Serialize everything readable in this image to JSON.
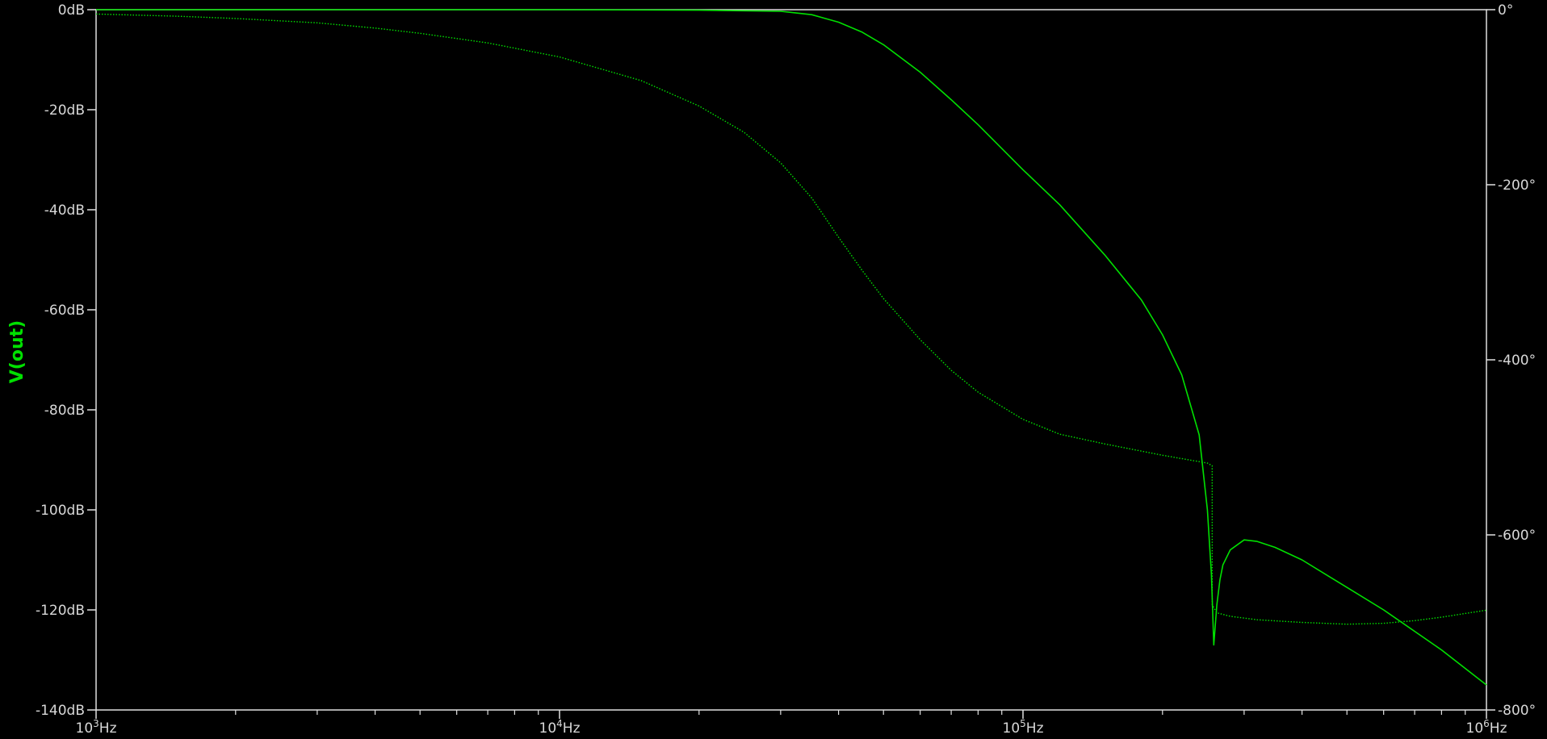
{
  "chart_data": {
    "type": "line",
    "ylabel": "V(out)",
    "x_scale": "log",
    "xlim": [
      1000,
      1000000
    ],
    "ylim_left": [
      -140,
      0
    ],
    "ylim_right": [
      -800,
      0
    ],
    "grid": false,
    "background_color": "#000000",
    "axis_color": "#e0e0e0",
    "trace_color": "#00e000",
    "x_ticks": [
      {
        "value": 1000,
        "base": "10",
        "exp": "3",
        "unit": "Hz"
      },
      {
        "value": 10000,
        "base": "10",
        "exp": "4",
        "unit": "Hz"
      },
      {
        "value": 100000,
        "base": "10",
        "exp": "5",
        "unit": "Hz"
      },
      {
        "value": 1000000,
        "base": "10",
        "exp": "6",
        "unit": "Hz"
      }
    ],
    "y_left_ticks": [
      {
        "value": 0,
        "label": "0dB"
      },
      {
        "value": -20,
        "label": "-20dB"
      },
      {
        "value": -40,
        "label": "-40dB"
      },
      {
        "value": -60,
        "label": "-60dB"
      },
      {
        "value": -80,
        "label": "-80dB"
      },
      {
        "value": -100,
        "label": "-100dB"
      },
      {
        "value": -120,
        "label": "-120dB"
      },
      {
        "value": -140,
        "label": "-140dB"
      }
    ],
    "y_right_ticks": [
      {
        "value": 0,
        "label": "0°"
      },
      {
        "value": -200,
        "label": "-200°"
      },
      {
        "value": -400,
        "label": "-400°"
      },
      {
        "value": -600,
        "label": "-600°"
      },
      {
        "value": -800,
        "label": "-800°"
      }
    ],
    "series": [
      {
        "axis": "left",
        "style": "solid",
        "x": [
          1000,
          5000,
          10000,
          20000,
          30000,
          35000,
          40000,
          45000,
          50000,
          60000,
          70000,
          80000,
          100000,
          120000,
          150000,
          180000,
          200000,
          220000,
          240000,
          250000,
          255000,
          258000,
          262000,
          266000,
          270000,
          280000,
          300000,
          320000,
          350000,
          400000,
          500000,
          600000,
          800000,
          1000000
        ],
        "y": [
          0,
          0,
          0,
          -0.1,
          -0.3,
          -1.0,
          -2.5,
          -4.5,
          -7.0,
          -12.5,
          -18.0,
          -23.0,
          -32.0,
          -39.0,
          -49.0,
          -58.0,
          -65.0,
          -73.0,
          -85.0,
          -100.0,
          -113.0,
          -127.0,
          -119.0,
          -114.0,
          -111.0,
          -108.0,
          -106.0,
          -106.3,
          -107.5,
          -110.0,
          -115.5,
          -120.0,
          -128.0,
          -135.0
        ]
      },
      {
        "axis": "right",
        "style": "dotted",
        "x": [
          1000,
          1500,
          2000,
          3000,
          4000,
          5000,
          7000,
          10000,
          15000,
          20000,
          25000,
          30000,
          35000,
          40000,
          45000,
          50000,
          60000,
          70000,
          80000,
          100000,
          120000,
          150000,
          200000,
          250000,
          256000,
          256100,
          262000,
          280000,
          320000,
          400000,
          500000,
          600000,
          700000,
          800000,
          1000000
        ],
        "y": [
          -5,
          -7.5,
          -10,
          -15,
          -21,
          -27,
          -38,
          -54,
          -81,
          -110,
          -140,
          -175,
          -215,
          -260,
          -298,
          -330,
          -377,
          -412,
          -437,
          -468,
          -485,
          -496,
          -509,
          -518,
          -521,
          -680,
          -689,
          -693,
          -697,
          -700,
          -702,
          -701,
          -698,
          -694,
          -686
        ]
      }
    ]
  }
}
